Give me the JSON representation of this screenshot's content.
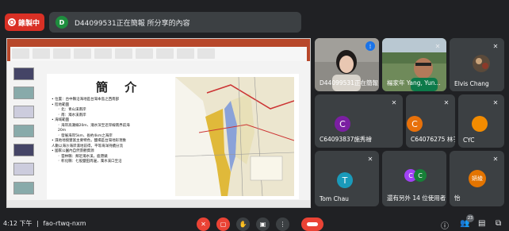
{
  "recording": {
    "label": "錄製中"
  },
  "presenter_bar": {
    "avatar_letter": "D",
    "text": "D44099531正在簡報 所分享的內容"
  },
  "slide": {
    "title": "簡 介",
    "bullets": [
      {
        "text": "• 位置：台中縣沿海地區台灣本島之西南部",
        "sub": false
      },
      {
        "text": "• 陸地範圍",
        "sub": false
      },
      {
        "text": "◦ 北：青山溪南岸",
        "sub": true
      },
      {
        "text": "◦ 南：濁水溪南岸",
        "sub": true
      },
      {
        "text": "• 海域範圍",
        "sub": false
      },
      {
        "text": "◦ 海岸高潮線20m、潮水深至近岸線南界前海",
        "sub": true
      },
      {
        "text": "20m",
        "sub": true
      },
      {
        "text": "◦ 發展海岸5km、長約4km之海岸",
        "sub": true
      },
      {
        "text": "• 濕地地貌豐富主要特色，鹽場區台灣地形現象",
        "sub": false
      },
      {
        "text": "人數以海沙海岸濕地前得，平等海洋持續分流",
        "sub": false
      },
      {
        "text": "• 國家公園內自然景觀資源",
        "sub": false
      },
      {
        "text": "◦ 雲林縣：鄰近濁水溪，鹿港鎮",
        "sub": true
      },
      {
        "text": "◦ 彰化縣：七股鹽田周邊，濁水溪口至沿",
        "sub": true
      }
    ]
  },
  "participants": [
    {
      "name": "D44099531正在簡報",
      "type": "video",
      "mic": "live"
    },
    {
      "name": "楊家年 Yang, Yun...",
      "type": "video",
      "mic": "muted"
    },
    {
      "name": "Elvis Chang",
      "type": "video",
      "mic": "muted"
    },
    {
      "name": "C64093837施秀檜",
      "type": "avatar",
      "initial": "C",
      "color": "#7b1fa2",
      "mic": "muted"
    },
    {
      "name": "C64076275 林于綾",
      "type": "avatar",
      "initial": "C",
      "color": "#e8710a",
      "mic": "muted"
    },
    {
      "name": "CYC",
      "type": "avatar",
      "initial": "",
      "color": "#f28b00",
      "mic": "muted"
    },
    {
      "name": "Tom Chau",
      "type": "avatar",
      "initial": "T",
      "color": "#1a9aba",
      "mic": "muted"
    },
    {
      "name": "還有另外 14 位使用者",
      "type": "group",
      "initials": [
        "C",
        "C"
      ],
      "mic": "none"
    },
    {
      "name": "怡",
      "type": "avatar",
      "initial": "妍綾",
      "color": "#e37400",
      "mic": "muted"
    }
  ],
  "bottom": {
    "time": "4:12 下午",
    "separator": "|",
    "meeting_code": "fao-rtwq-nxm",
    "people_count": "23"
  }
}
